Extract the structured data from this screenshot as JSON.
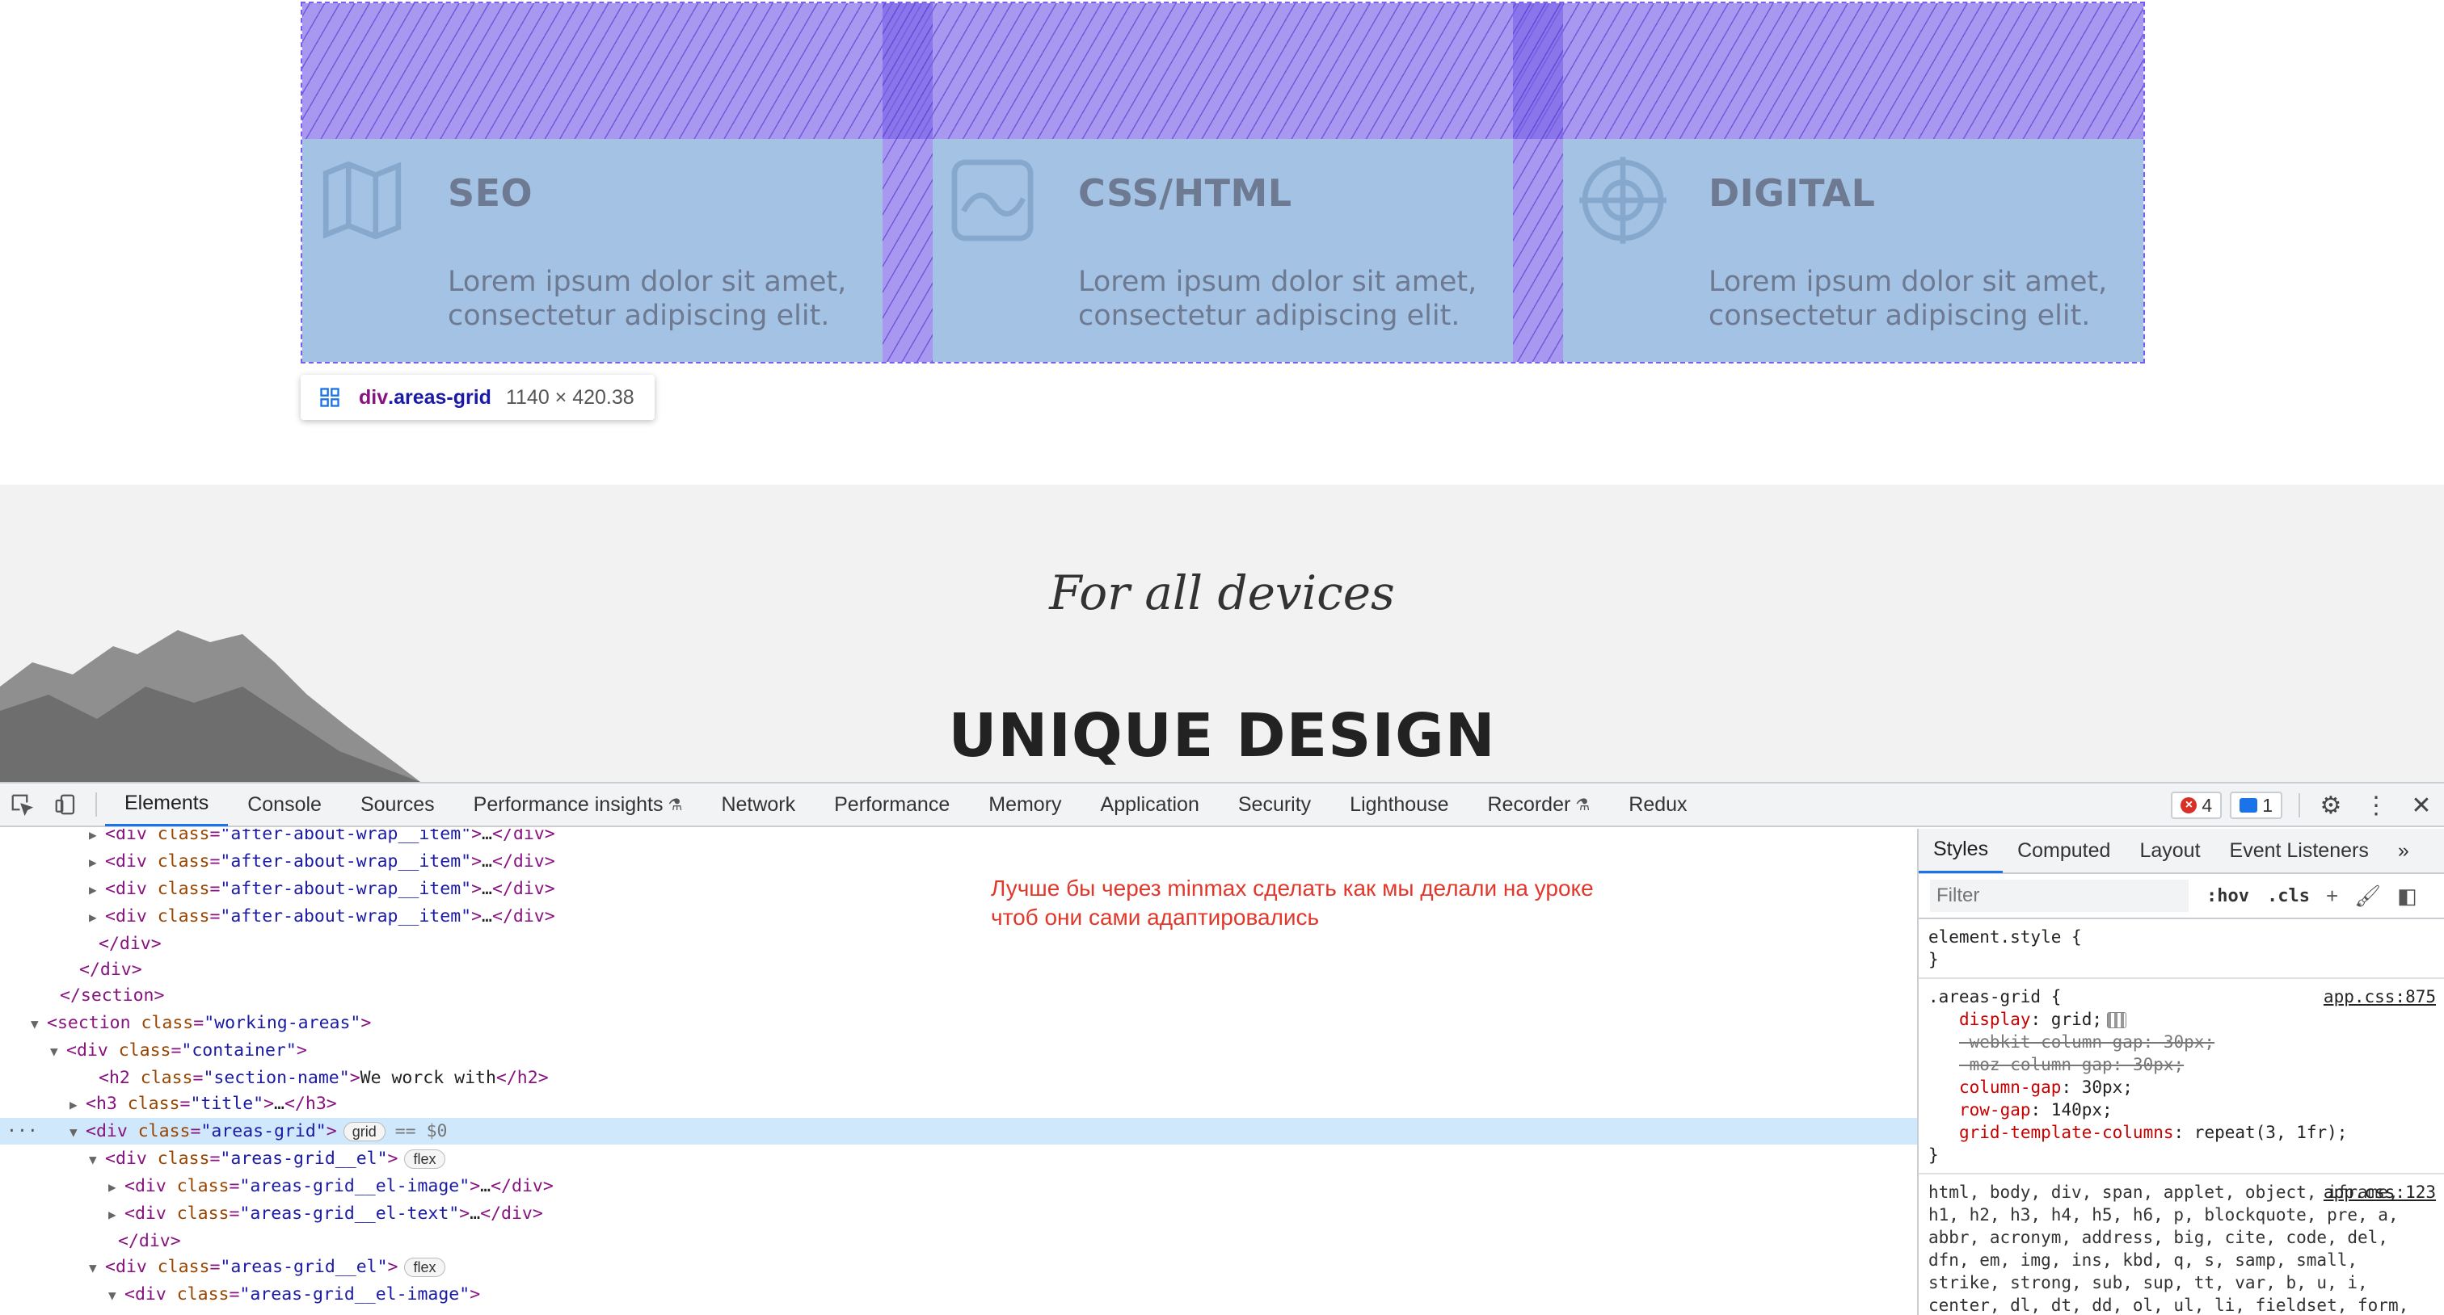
{
  "website": {
    "areas": [
      {
        "title": "SEO",
        "text": "Lorem ipsum dolor sit amet, consectetur adipiscing elit.",
        "icon": "map-icon"
      },
      {
        "title": "CSS/HTML",
        "text": "Lorem ipsum dolor sit amet, consectetur adipiscing elit.",
        "icon": "image-frame-icon"
      },
      {
        "title": "DIGITAL",
        "text": "Lorem ipsum dolor sit amet, consectetur adipiscing elit.",
        "icon": "target-icon"
      }
    ],
    "inspect_tooltip": {
      "tag": "div",
      "class": ".areas-grid",
      "size": "1140 × 420.38"
    },
    "section_tag": "For all devices",
    "section_heading": "UNIQUE DESIGN"
  },
  "devtools": {
    "tabs": [
      "Elements",
      "Console",
      "Sources",
      "Performance insights",
      "Network",
      "Performance",
      "Memory",
      "Application",
      "Security",
      "Lighthouse",
      "Recorder",
      "Redux"
    ],
    "active_tab": "Elements",
    "error_count": "4",
    "message_count": "1",
    "dom_lines": [
      {
        "t": "▶",
        "tag": "div",
        "cls": "after-about-wrap__item",
        "rest": "…</div>"
      },
      {
        "t": "▶",
        "tag": "div",
        "cls": "after-about-wrap__item",
        "rest": "…</div>"
      },
      {
        "t": "▶",
        "tag": "div",
        "cls": "after-about-wrap__item",
        "rest": "…</div>"
      },
      {
        "t": "▶",
        "tag": "div",
        "cls": "after-about-wrap__item",
        "rest": "…</div>"
      },
      {
        "close": "</div>"
      },
      {
        "close": "</div>"
      },
      {
        "close": "</section>"
      },
      {
        "t": "▼",
        "tag": "section",
        "cls": "working-areas",
        "rest": ""
      },
      {
        "t": "▼",
        "tag": "div",
        "cls": "container",
        "rest": ""
      },
      {
        "t": "",
        "tag": "h2",
        "cls": "section-name",
        "rest": "We worck with</h2>"
      },
      {
        "t": "▶",
        "tag": "h3",
        "cls": "title",
        "rest": "…</h3>"
      },
      {
        "t": "▼",
        "tag": "div",
        "cls": "areas-grid",
        "rest": "",
        "pill": "grid",
        "eq": "== $0"
      },
      {
        "t": "▼",
        "tag": "div",
        "cls": "areas-grid__el",
        "rest": "",
        "pill": "flex"
      },
      {
        "t": "▶",
        "tag": "div",
        "cls": "areas-grid__el-image",
        "rest": "…</div>"
      },
      {
        "t": "▶",
        "tag": "div",
        "cls": "areas-grid__el-text",
        "rest": "…</div>"
      },
      {
        "close": "</div>"
      },
      {
        "t": "▼",
        "tag": "div",
        "cls": "areas-grid__el",
        "rest": "",
        "pill": "flex"
      },
      {
        "t": "▼",
        "tag": "div",
        "cls": "areas-grid__el-image",
        "rest": ""
      }
    ],
    "annotation": "Лучше бы через minmax сделать как мы делали на уроке чтоб они сами адаптировались",
    "styles_tabs": [
      "Styles",
      "Computed",
      "Layout",
      "Event Listeners"
    ],
    "filter_placeholder": "Filter",
    "hov": ":hov",
    "cls": ".cls",
    "element_style": "element.style {",
    "rule": {
      "selector": ".areas-grid {",
      "source": "app.css:875",
      "props": [
        {
          "name": "display",
          "value": "grid;",
          "struck": false
        },
        {
          "name": "-webkit-column-gap",
          "value": "30px;",
          "struck": true
        },
        {
          "name": "-moz-column-gap",
          "value": "30px;",
          "struck": true
        },
        {
          "name": "column-gap",
          "value": "30px;",
          "struck": false
        },
        {
          "name": "row-gap",
          "value": "140px;",
          "struck": false
        },
        {
          "name": "grid-template-columns",
          "value": "repeat(3, 1fr);",
          "struck": false
        }
      ]
    },
    "reset_rule": {
      "source": "app.css:123",
      "selectors": "html, body, div, span, applet, object, iframe, h1, h2, h3, h4, h5, h6, p, blockquote, pre, a, abbr, acronym, address, big, cite, code, del, dfn, em, img, ins, kbd, q, s, samp, small, strike, strong, sub, sup, tt, var, b, u, i, center, dl, dt, dd, ol, ul, li, fieldset, form, label, legend,"
    }
  }
}
